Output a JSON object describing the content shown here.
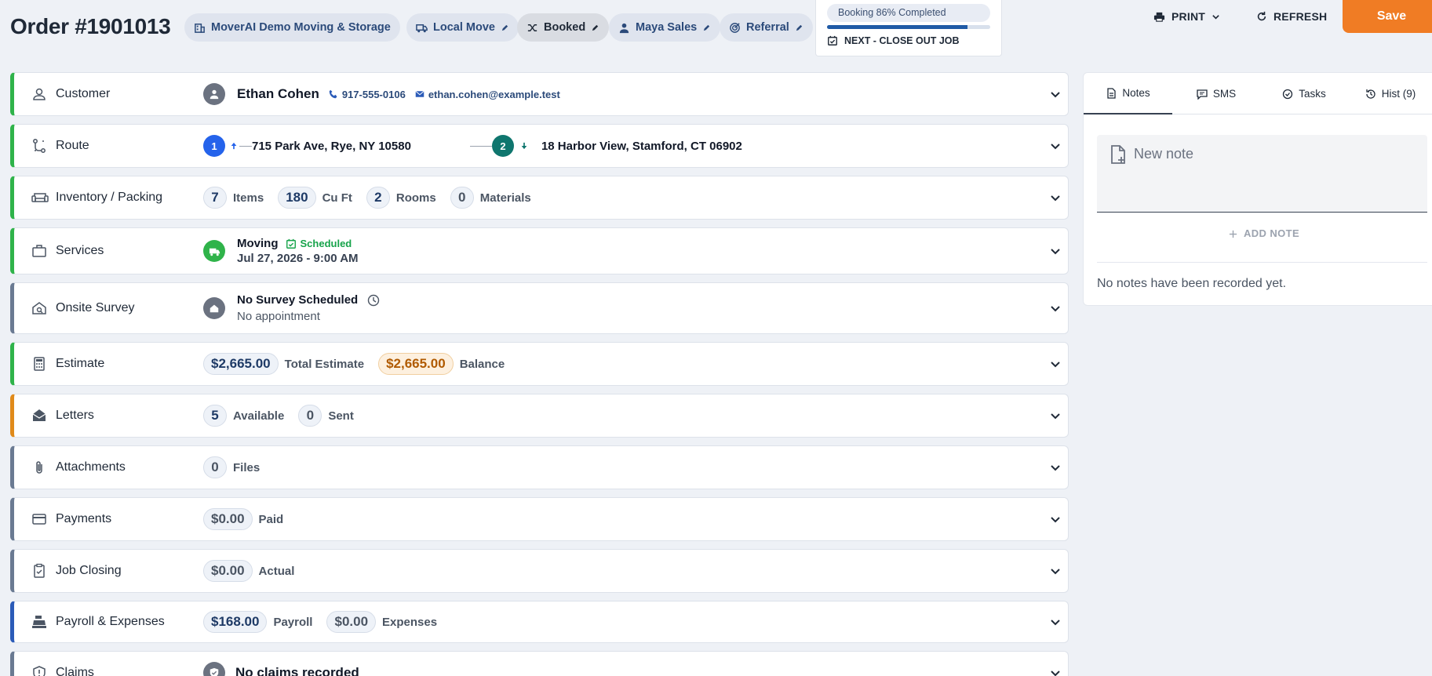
{
  "header": {
    "order_title": "Order #1901013",
    "chips": {
      "company": "MoverAI Demo Moving & Storage",
      "move_type": "Local Move",
      "status": "Booked",
      "sales": "Maya Sales",
      "source": "Referral"
    },
    "progress": {
      "label": "Booking 86% Completed",
      "percent": 86,
      "next_step": "NEXT - CLOSE OUT JOB"
    },
    "print_label": "PRINT",
    "refresh_label": "REFRESH",
    "save_label": "Save"
  },
  "sections": {
    "customer": {
      "label": "Customer",
      "name": "Ethan Cohen",
      "phone": "917-555-0106",
      "email": "ethan.cohen@example.test"
    },
    "route": {
      "label": "Route",
      "stop1_num": "1",
      "stop1_addr": "715 Park Ave, Rye, NY 10580",
      "stop2_num": "2",
      "stop2_addr": "18 Harbor View, Stamford, CT 06902"
    },
    "inventory": {
      "label": "Inventory / Packing",
      "items_count": "7",
      "items_label": "Items",
      "cuft_count": "180",
      "cuft_label": "Cu Ft",
      "rooms_count": "2",
      "rooms_label": "Rooms",
      "materials_count": "0",
      "materials_label": "Materials"
    },
    "services": {
      "label": "Services",
      "service_name": "Moving",
      "status": "Scheduled",
      "datetime": "Jul 27, 2026 - 9:00 AM"
    },
    "survey": {
      "label": "Onsite Survey",
      "title": "No Survey Scheduled",
      "subtitle": "No appointment"
    },
    "estimate": {
      "label": "Estimate",
      "total": "$2,665.00",
      "total_label": "Total Estimate",
      "balance": "$2,665.00",
      "balance_label": "Balance"
    },
    "letters": {
      "label": "Letters",
      "available": "5",
      "available_label": "Available",
      "sent": "0",
      "sent_label": "Sent"
    },
    "attachments": {
      "label": "Attachments",
      "files": "0",
      "files_label": "Files"
    },
    "payments": {
      "label": "Payments",
      "paid": "$0.00",
      "paid_label": "Paid"
    },
    "job_closing": {
      "label": "Job Closing",
      "actual": "$0.00",
      "actual_label": "Actual"
    },
    "payroll": {
      "label": "Payroll & Expenses",
      "payroll": "$168.00",
      "payroll_label": "Payroll",
      "expenses": "$0.00",
      "expenses_label": "Expenses"
    },
    "claims": {
      "label": "Claims",
      "text": "No claims recorded"
    }
  },
  "panel": {
    "tabs": {
      "notes": "Notes",
      "sms": "SMS",
      "tasks": "Tasks",
      "hist": "Hist (9)"
    },
    "note_placeholder": "New note",
    "add_note": "ADD NOTE",
    "empty_text": "No notes have been recorded yet."
  },
  "colors": {
    "accent": "#f07c24",
    "section_green": "#2fb34a",
    "section_gray": "#6a7a92",
    "section_orange": "#e08a1a",
    "section_blue": "#2b5bb8",
    "progress": "#1f5aa6"
  }
}
